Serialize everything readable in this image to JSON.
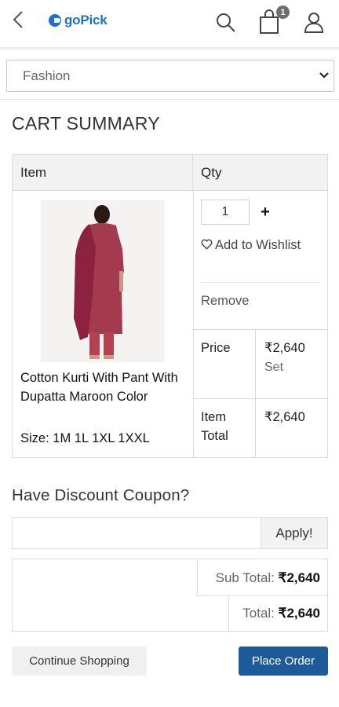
{
  "header": {
    "brand": "goPick",
    "cart_count": "1"
  },
  "category": {
    "selected": "Fashion"
  },
  "page_title": "CART SUMMARY",
  "cart_table": {
    "col_item": "Item",
    "col_qty": "Qty",
    "product": {
      "name": "Cotton Kurti With Pant With Dupatta Maroon Color",
      "size": "Size: 1M 1L 1XL 1XXL",
      "qty": "1",
      "plus": "+",
      "wishlist_label": "Add to Wishlist",
      "remove_label": "Remove",
      "price_label": "Price",
      "price_value": "₹2,640",
      "price_unit": "Set",
      "item_total_label": "Item Total",
      "item_total_value": "₹2,640"
    }
  },
  "coupon": {
    "heading": "Have Discount Coupon?",
    "placeholder": "",
    "apply_label": "Apply!"
  },
  "totals": {
    "subtotal_label": "Sub Total:",
    "subtotal_value": "₹2,640",
    "total_label": "Total:",
    "total_value": "₹2,640"
  },
  "actions": {
    "continue_label": "Continue Shopping",
    "place_order_label": "Place Order"
  },
  "colors": {
    "brand": "#1a73c9",
    "primary_button": "#1c5a9a",
    "garment": "#a43a4d"
  }
}
